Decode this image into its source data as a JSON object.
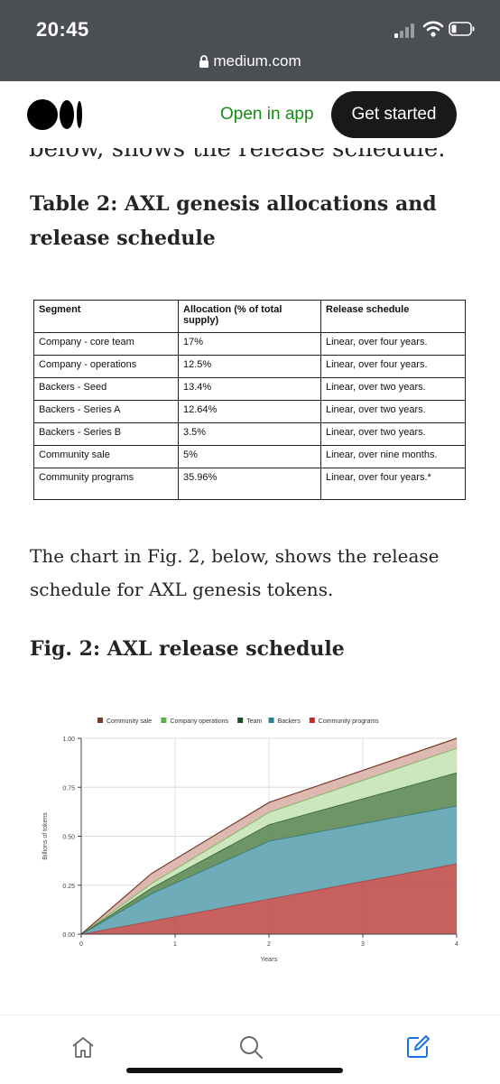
{
  "status_bar": {
    "time": "20:45",
    "url": "medium.com"
  },
  "header": {
    "open_in_app": "Open in app",
    "get_started": "Get started"
  },
  "article": {
    "cutoff_text": "below, shows the release schedule.",
    "table_title": "Table 2: AXL genesis allocations and release schedule",
    "table": {
      "headers": [
        "Segment",
        "Allocation (% of total supply)",
        "Release schedule"
      ],
      "rows": [
        [
          "Company - core team",
          "17%",
          "Linear, over four years."
        ],
        [
          "Company - operations",
          "12.5%",
          "Linear, over four years."
        ],
        [
          "Backers - Seed",
          "13.4%",
          "Linear, over two years."
        ],
        [
          "Backers - Series A",
          "12.64%",
          "Linear, over two years."
        ],
        [
          "Backers - Series B",
          "3.5%",
          "Linear, over two years."
        ],
        [
          "Community sale",
          "5%",
          "Linear, over nine months."
        ],
        [
          "Community programs",
          "35.96%",
          "Linear, over four years.*"
        ]
      ]
    },
    "paragraph": "The chart in Fig. 2, below, shows the release schedule for AXL genesis tokens.",
    "fig_title": "Fig. 2: AXL release schedule"
  },
  "chart_data": {
    "type": "area",
    "stacked": true,
    "xlabel": "Years",
    "ylabel": "Billions of tokens",
    "xlim": [
      0,
      4
    ],
    "ylim": [
      0,
      1.0
    ],
    "x_ticks": [
      "0",
      "1",
      "2",
      "3",
      "4"
    ],
    "y_ticks": [
      "0.00",
      "0.25",
      "0.50",
      "0.75",
      "1.00"
    ],
    "legend_position": "top",
    "grid": true,
    "x": [
      0,
      0.75,
      2,
      4
    ],
    "series": [
      {
        "name": "Community programs",
        "color": "#c0504d",
        "values": [
          0,
          0.067,
          0.18,
          0.36
        ]
      },
      {
        "name": "Backers",
        "color": "#5fa3b2",
        "values": [
          0,
          0.14,
          0.295,
          0.295
        ]
      },
      {
        "name": "Team",
        "color": "#5e8a55",
        "values": [
          0,
          0.03,
          0.085,
          0.17
        ]
      },
      {
        "name": "Company operations",
        "color": "#c6e4b6",
        "values": [
          0,
          0.023,
          0.0625,
          0.125
        ]
      },
      {
        "name": "Community sale",
        "color": "#d8b3aa",
        "values": [
          0,
          0.05,
          0.05,
          0.05
        ]
      }
    ],
    "legend": [
      {
        "name": "Community sale",
        "color": "#7b3b2a"
      },
      {
        "name": "Company operations",
        "color": "#5cb146"
      },
      {
        "name": "Team",
        "color": "#1f4d1f"
      },
      {
        "name": "Backers",
        "color": "#2f7d92"
      },
      {
        "name": "Community programs",
        "color": "#c0302b"
      }
    ]
  }
}
